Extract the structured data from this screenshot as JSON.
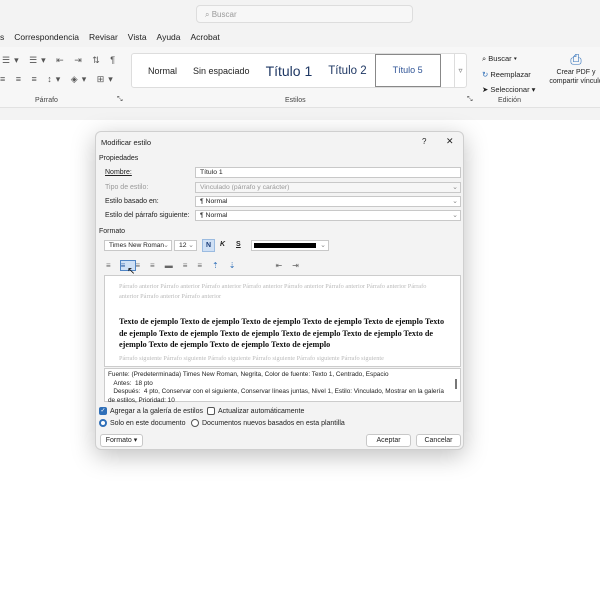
{
  "search": {
    "placeholder": "Buscar"
  },
  "tabs": [
    "s",
    "Correspondencia",
    "Revisar",
    "Vista",
    "Ayuda",
    "Acrobat"
  ],
  "ribbon": {
    "paragraph_group": "Párrafo",
    "styles_group": "Estilos",
    "styles": [
      "Normal",
      "Sin espaciado",
      "Título 1",
      "Título 2",
      "Título 5"
    ],
    "edit_group": "Edición",
    "find": "Buscar",
    "replace": "Reemplazar",
    "select": "Seleccionar",
    "pdf_line1": "Crear PDF y",
    "pdf_line2": "compartir vínculo"
  },
  "dialog": {
    "title": "Modificar estilo",
    "help": "?",
    "close": "✕",
    "properties": "Propiedades",
    "name_label": "Nombre:",
    "name_value": "Título 1",
    "type_label": "Tipo de estilo:",
    "type_value": "Vinculado (párrafo y carácter)",
    "based_label": "Estilo basado en:",
    "based_value": "¶  Normal",
    "next_label": "Estilo del párrafo siguiente:",
    "next_value": "¶  Normal",
    "format": "Formato",
    "font": "Times New Roman",
    "size": "12",
    "bold": "N",
    "italic": "K",
    "underline": "S",
    "font_color": "#000000",
    "prev_text": "Párrafo anterior Párrafo anterior Párrafo anterior Párrafo anterior Párrafo anterior Párrafo anterior Párrafo anterior Párrafo anterior Párrafo anterior Párrafo anterior",
    "sample_text": "Texto de ejemplo Texto de ejemplo Texto de ejemplo Texto de ejemplo Texto de ejemplo Texto de ejemplo Texto de ejemplo Texto de ejemplo Texto de ejemplo Texto de ejemplo Texto de ejemplo Texto de ejemplo Texto de ejemplo Texto de ejemplo",
    "next_text": "Párrafo siguiente Párrafo siguiente Párrafo siguiente Párrafo siguiente Párrafo siguiente Párrafo siguiente",
    "description": "Fuente: (Predeterminada) Times New Roman, Negrita, Color de fuente: Texto 1, Centrado, Espacio\n   Antes:  18 pto\n   Después:  4 pto, Conservar con el siguiente, Conservar líneas juntas, Nivel 1, Estilo: Vinculado, Mostrar en la galería de estilos, Prioridad: 10",
    "add_gallery": "Agregar a la galería de estilos",
    "add_gallery_checked": true,
    "auto_update": "Actualizar automáticamente",
    "auto_update_checked": false,
    "only_doc": "Solo en este documento",
    "new_docs": "Documentos nuevos basados en esta plantilla",
    "format_btn": "Formato ▾",
    "ok": "Aceptar",
    "cancel": "Cancelar"
  }
}
